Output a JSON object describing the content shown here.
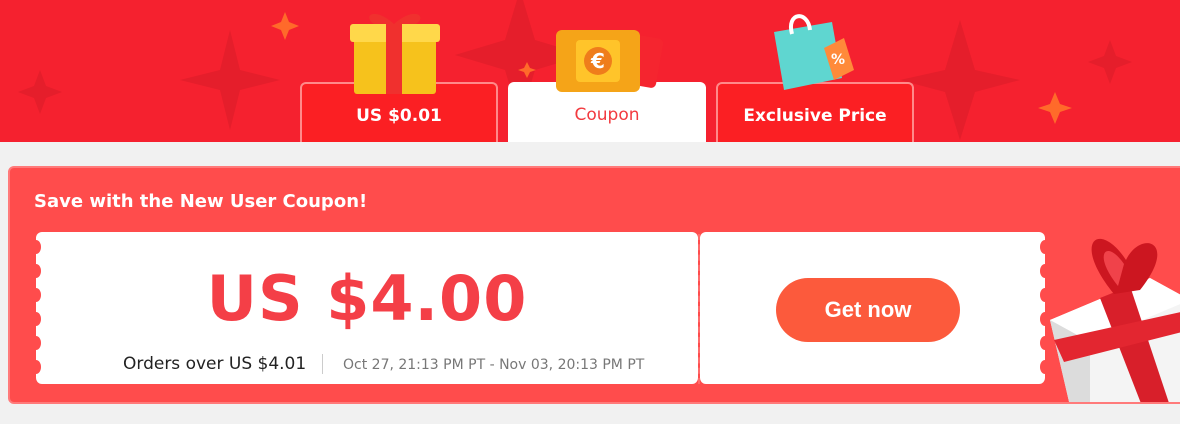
{
  "tabs": [
    {
      "label": "US $0.01",
      "active": false,
      "icon": "gift-box-icon"
    },
    {
      "label": "Coupon",
      "active": true,
      "icon": "euro-coupon-icon"
    },
    {
      "label": "Exclusive Price",
      "active": false,
      "icon": "shopping-bag-percent-icon"
    }
  ],
  "panel": {
    "title": "Save with the New User Coupon!",
    "coupon": {
      "amount": "US $4.00",
      "condition": "Orders over US $4.01",
      "validity": "Oct 27, 21:13 PM PT - Nov 03, 20:13 PM PT"
    },
    "cta_label": "Get now"
  },
  "colors": {
    "banner_red": "#f5212f",
    "panel_red": "#ff4c4c",
    "amount_red": "#f43f47",
    "cta_orange": "#fc5a3c"
  }
}
